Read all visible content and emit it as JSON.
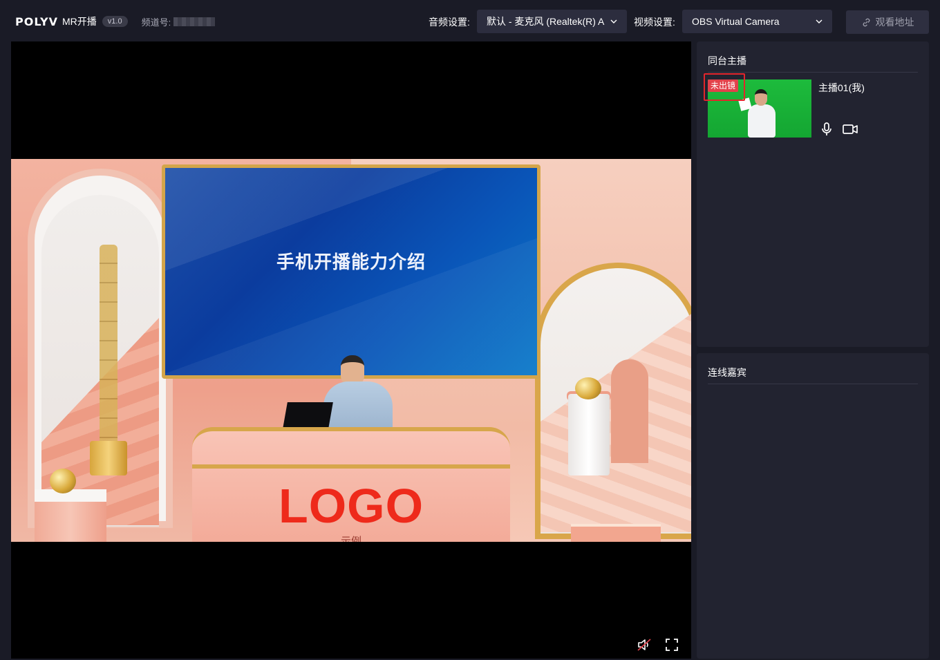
{
  "header": {
    "logo": "POLYV",
    "product": "MR开播",
    "version": "v1.0",
    "channel_label": "频道号:",
    "audio_label": "音频设置:",
    "audio_value": "默认 - 麦克风 (Realtek(R) A",
    "video_label": "视频设置:",
    "video_value": "OBS Virtual Camera",
    "watch_button": "观看地址"
  },
  "stage": {
    "slide_title": "手机开播能力介绍",
    "desk_logo": "LOGO",
    "desk_sub": "示例"
  },
  "hosts_panel": {
    "title": "同台主播",
    "hosts": [
      {
        "name": "主播01(我)",
        "badge": "未出镜"
      }
    ]
  },
  "guests_panel": {
    "title": "连线嘉宾"
  },
  "icons": {
    "link": "link-icon",
    "chevron": "chevron-down-icon",
    "mic": "microphone-icon",
    "camera": "camera-icon",
    "mute": "speaker-muted-icon",
    "fullscreen": "fullscreen-icon"
  },
  "colors": {
    "background": "#1a1b26",
    "panel": "#222330",
    "badge": "#e3414b",
    "highlight_border": "#e3252b"
  }
}
